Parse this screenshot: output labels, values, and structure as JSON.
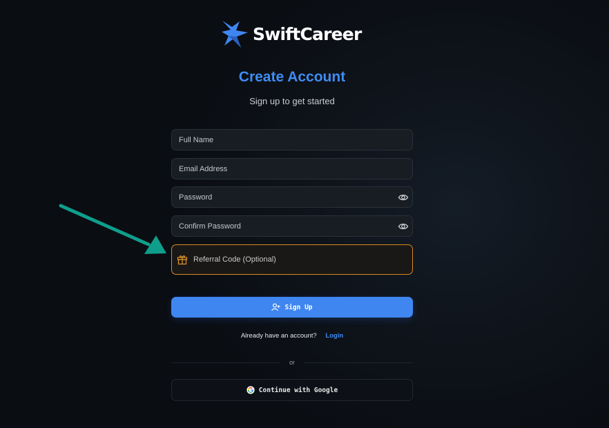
{
  "brand": {
    "name": "SwiftCareer"
  },
  "header": {
    "title": "Create Account",
    "subtitle": "Sign up to get started"
  },
  "form": {
    "full_name": {
      "placeholder": "Full Name",
      "value": ""
    },
    "email": {
      "placeholder": "Email Address",
      "value": ""
    },
    "password": {
      "placeholder": "Password",
      "value": ""
    },
    "confirm_password": {
      "placeholder": "Confirm Password",
      "value": ""
    },
    "referral": {
      "placeholder": "Referral Code (Optional)",
      "value": ""
    }
  },
  "actions": {
    "signup_label": "Sign Up",
    "already_text": "Already have an account?",
    "login_label": "Login",
    "or_text": "or",
    "google_label": "Continue with Google"
  },
  "icons": {
    "logo": "star-logo-icon",
    "eye": "eye-icon",
    "gift": "gift-icon",
    "user_plus": "user-plus-icon",
    "google": "google-icon",
    "arrow": "annotation-arrow"
  },
  "colors": {
    "accent": "#3f8cf3",
    "referral_border": "#d98b20",
    "annotation_arrow": "#0f9e8c",
    "background": "#0b0e13"
  }
}
